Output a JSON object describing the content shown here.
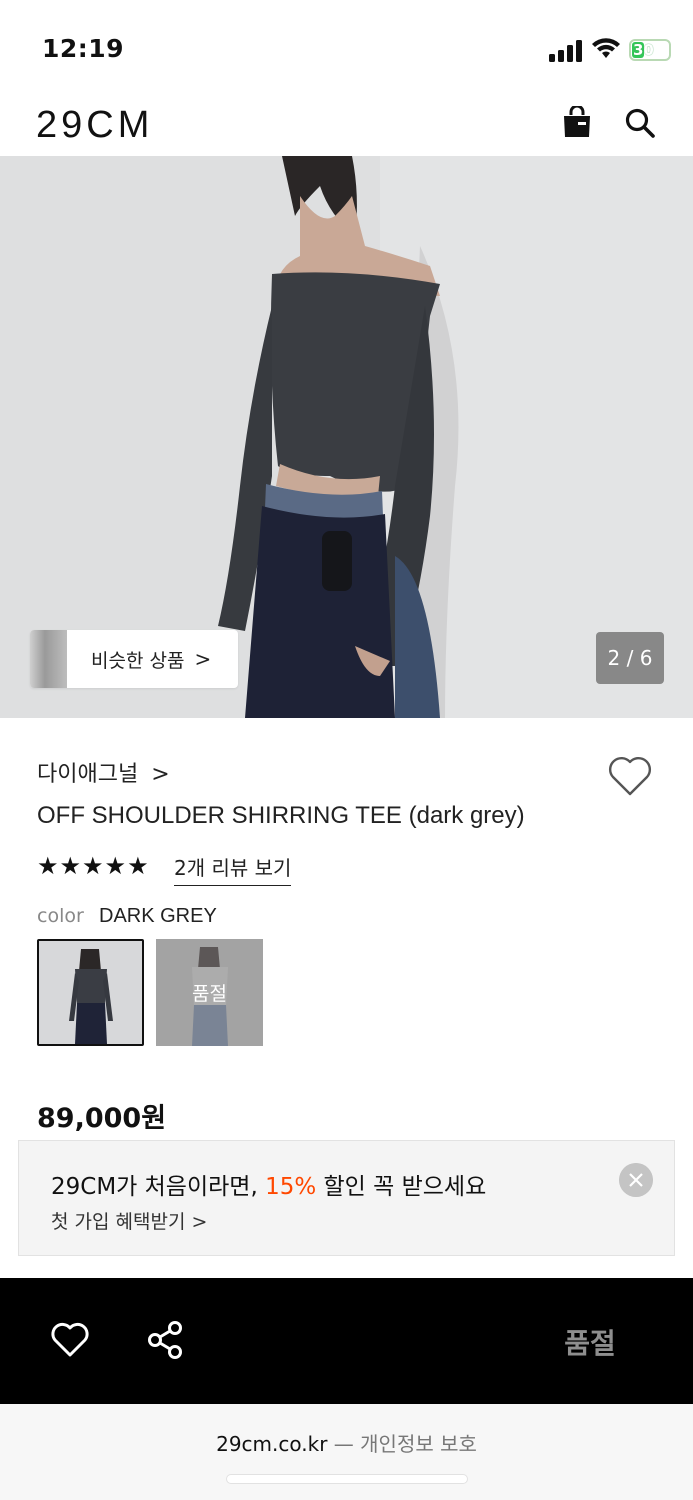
{
  "status_bar": {
    "time": "12:19",
    "battery": "30"
  },
  "header": {
    "logo": "29CM",
    "icons": [
      "shopping-bag-icon",
      "search-icon"
    ]
  },
  "hero": {
    "similar_label": "비슷한 상품",
    "similar_chevron": ">",
    "page_counter": "2 / 6"
  },
  "product": {
    "brand": "다이애그널",
    "brand_chevron": ">",
    "name": "OFF SHOULDER SHIRRING TEE (dark grey)",
    "stars": "★★★★★",
    "rating": "5 of 5",
    "review_link": "2개 리뷰 보기",
    "color_label": "color",
    "color_value": "DARK GREY",
    "swatch_soldout_label": "품절",
    "price": "89,000원"
  },
  "promo": {
    "title_prefix": "29CM가 처음이라면, ",
    "title_highlight": "15%",
    "title_suffix": " 할인 꼭 받으세요",
    "subtitle": "첫 가입 혜택받기 >",
    "highlight_color": "#ff4800"
  },
  "bottom_bar": {
    "action_label": "품절"
  },
  "browser": {
    "domain": "29cm.co.kr",
    "separator": " — ",
    "privacy": "개인정보 보호"
  }
}
